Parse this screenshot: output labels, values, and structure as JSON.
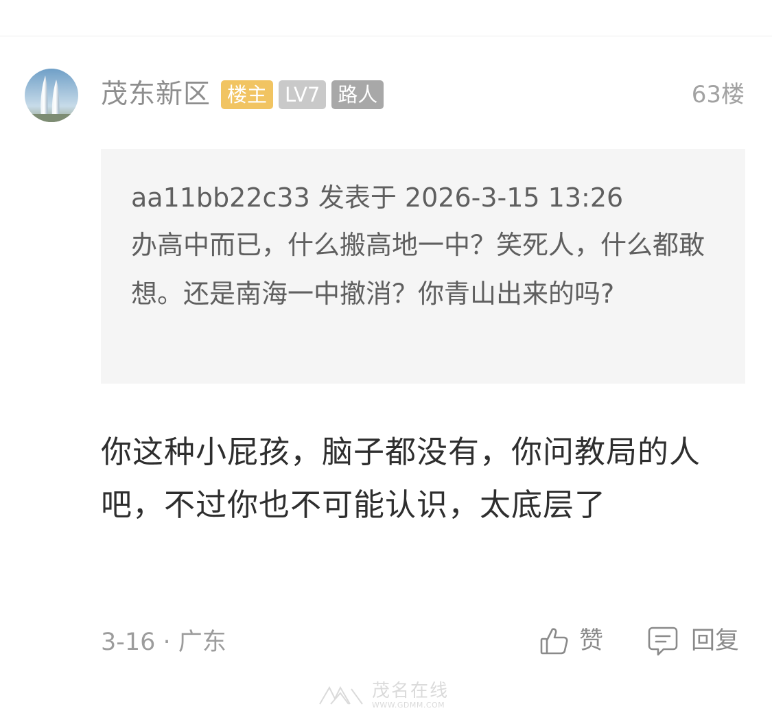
{
  "post": {
    "username": "茂东新区",
    "badges": {
      "owner": "楼主",
      "level": "LV7",
      "rank": "路人"
    },
    "floor": "63楼",
    "quote": {
      "meta": "aa11bb22c33 发表于 2026-3-15 13:26",
      "text": "办高中而已，什么搬高地一中？笑死人，什么都敢想。还是南海一中撤消？你青山出来的吗?"
    },
    "reply": "你这种小屁孩，脑子都没有，你问教局的人吧，不过你也不可能认识，太底层了",
    "footer": {
      "meta": "3-16 · 广东",
      "like_label": "赞",
      "reply_label": "回复"
    }
  },
  "watermark": {
    "text": "茂名在线",
    "url": "WWW.GDMM.COM"
  },
  "icons": {
    "avatar": "avatar-twin-towers",
    "like": "thumbs-up-icon",
    "reply": "comment-icon",
    "logo": "site-logo-icon"
  },
  "colors": {
    "owner_badge": "#f1c462",
    "level_badge": "#c9c9c9",
    "rank_badge": "#a8a8a8",
    "quote_background": "#f5f5f5"
  }
}
